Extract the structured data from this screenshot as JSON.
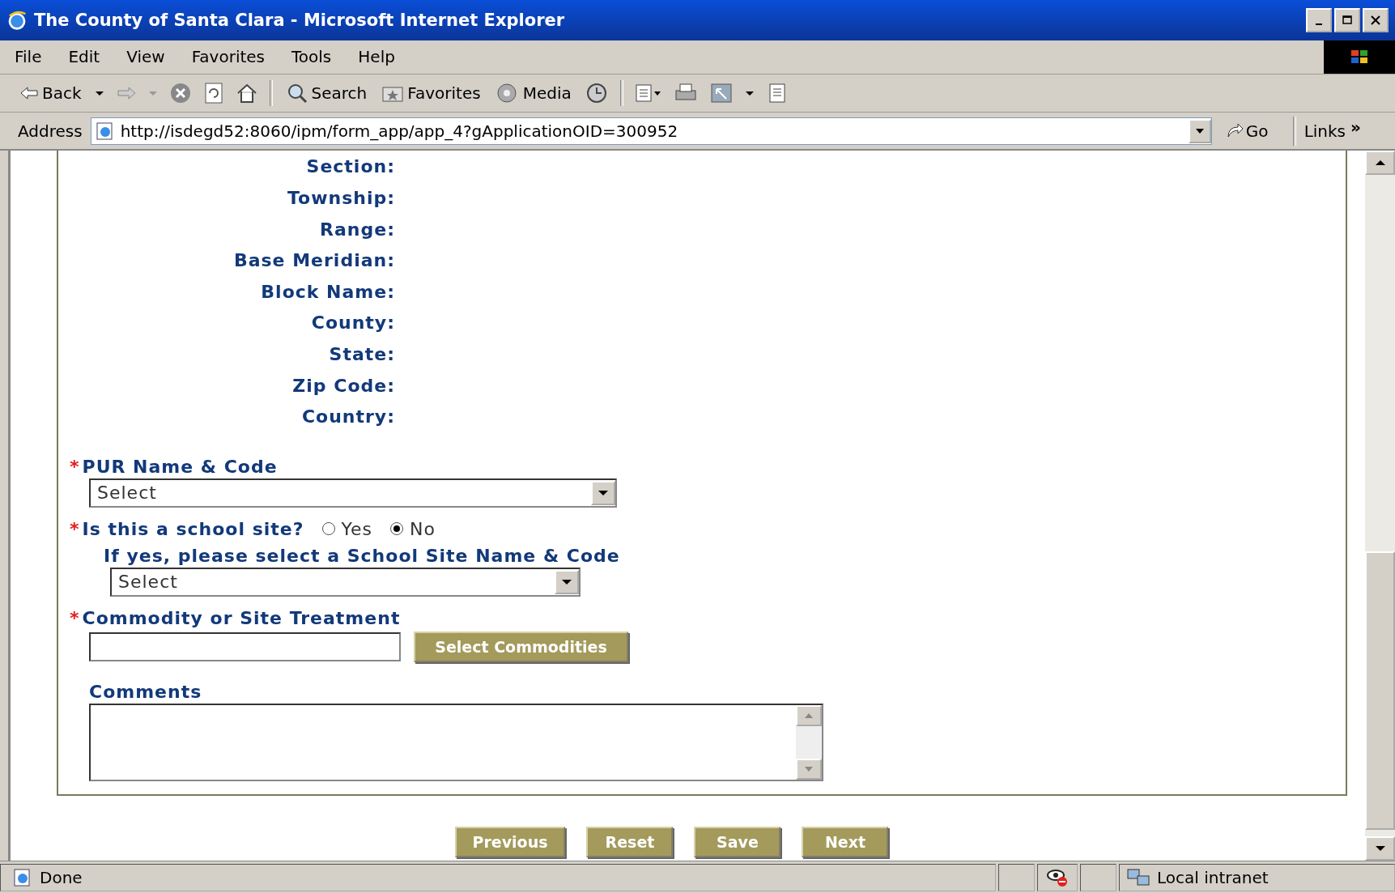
{
  "window": {
    "title": "The County of Santa Clara - Microsoft Internet Explorer"
  },
  "menu": [
    "File",
    "Edit",
    "View",
    "Favorites",
    "Tools",
    "Help"
  ],
  "toolbar": {
    "back": "Back",
    "search": "Search",
    "favorites": "Favorites",
    "media": "Media"
  },
  "address_bar": {
    "label": "Address",
    "url": "http://isdegd52:8060/ipm/form_app/app_4?gApplicationOID=300952",
    "go": "Go",
    "links": "Links",
    "more": "»"
  },
  "location_labels": [
    "Section:",
    "Township:",
    "Range:",
    "Base Meridian:",
    "Block Name:",
    "County:",
    "State:",
    "Zip Code:",
    "Country:"
  ],
  "pur": {
    "required_mark": "*",
    "label": "PUR Name & Code",
    "value": "Select"
  },
  "school_site": {
    "required_mark": "*",
    "label": "Is this a school site?",
    "options": [
      {
        "label": "Yes",
        "selected": false
      },
      {
        "label": "No",
        "selected": true
      }
    ],
    "sub_label": "If yes, please select a School Site Name & Code",
    "value": "Select"
  },
  "commodity": {
    "required_mark": "*",
    "label": "Commodity or Site Treatment",
    "button": "Select Commodities"
  },
  "comments": {
    "label": "Comments"
  },
  "buttons": [
    "Previous",
    "Reset",
    "Save",
    "Next"
  ],
  "status_bar": {
    "text": "Done",
    "zone": "Local intranet"
  }
}
